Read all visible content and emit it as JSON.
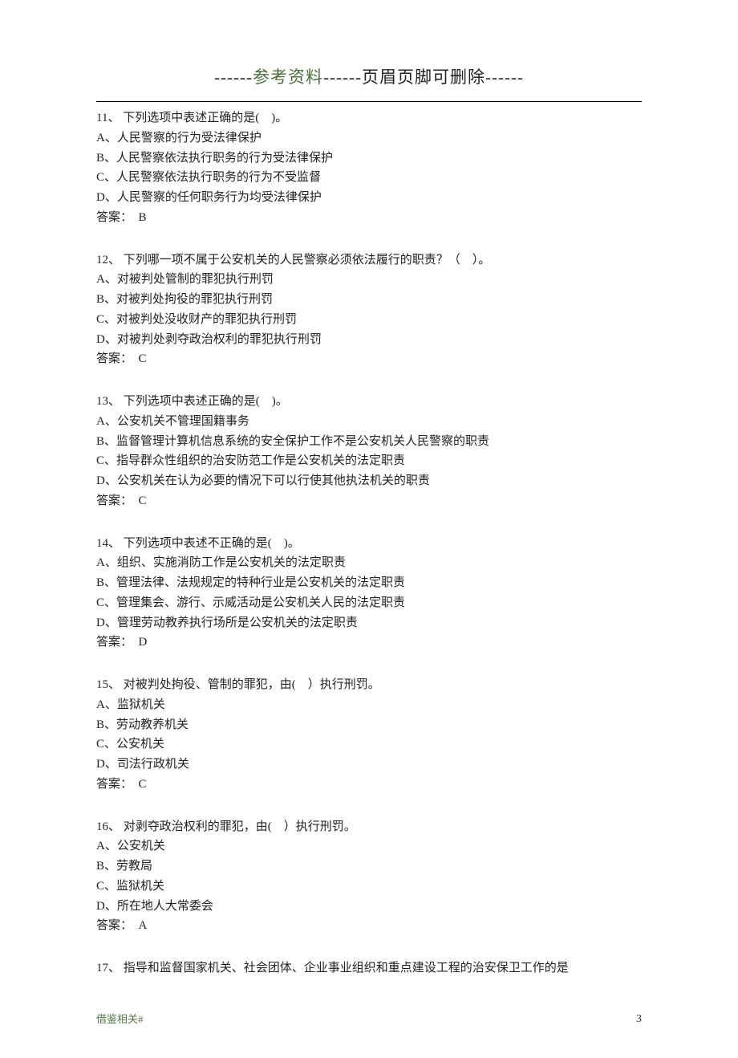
{
  "header": {
    "dashes_prefix": "------",
    "ref_text": "参考资料",
    "dashes_mid": "------",
    "suffix_text": "页眉页脚可删除",
    "dashes_suffix": "------"
  },
  "questions": [
    {
      "num": "11、",
      "stem": " 下列选项中表述正确的是(    )。",
      "options": [
        "A、人民警察的行为受法律保护",
        "B、人民警察依法执行职务的行为受法律保护",
        "C、人民警察依法执行职务的行为不受监督",
        "D、人民警察的任何职务行为均受法律保护"
      ],
      "answer_label": "答案：  B"
    },
    {
      "num": "12、",
      "stem": " 下列哪一项不属于公安机关的人民警察必须依法履行的职责？（    ）。",
      "options": [
        "A、对被判处管制的罪犯执行刑罚",
        "B、对被判处拘役的罪犯执行刑罚",
        "C、对被判处没收财产的罪犯执行刑罚",
        "D、对被判处剥夺政治权利的罪犯执行刑罚"
      ],
      "answer_label": "答案：  C"
    },
    {
      "num": "13、",
      "stem": " 下列选项中表述正确的是(    )。",
      "options": [
        "A、公安机关不管理国籍事务",
        "B、监督管理计算机信息系统的安全保护工作不是公安机关人民警察的职责",
        "C、指导群众性组织的治安防范工作是公安机关的法定职责",
        "D、公安机关在认为必要的情况下可以行使其他执法机关的职责"
      ],
      "answer_label": "答案：  C"
    },
    {
      "num": "14、",
      "stem": " 下列选项中表述不正确的是(    )。",
      "options": [
        "A、组织、实施消防工作是公安机关的法定职责",
        "B、管理法律、法规规定的特种行业是公安机关的法定职责",
        "C、管理集会、游行、示威活动是公安机关人民的法定职责",
        "D、管理劳动教养执行场所是公安机关的法定职责"
      ],
      "answer_label": "答案：  D"
    },
    {
      "num": "15、",
      "stem": " 对被判处拘役、管制的罪犯，由(    ）执行刑罚。",
      "options": [
        "A、监狱机关",
        "B、劳动教养机关",
        "C、公安机关",
        "D、司法行政机关"
      ],
      "answer_label": "答案：  C"
    },
    {
      "num": "16、",
      "stem": " 对剥夺政治权利的罪犯，由(    ）执行刑罚。",
      "options": [
        "A、公安机关",
        "B、劳教局",
        "C、监狱机关",
        "D、所在地人大常委会"
      ],
      "answer_label": "答案：  A"
    },
    {
      "num": "17、",
      "stem": " 指导和监督国家机关、社会团体、企业事业组织和重点建设工程的治安保卫工作的是",
      "options": [],
      "answer_label": ""
    }
  ],
  "footer": {
    "left": "借鉴相关#",
    "page_number": "3"
  }
}
